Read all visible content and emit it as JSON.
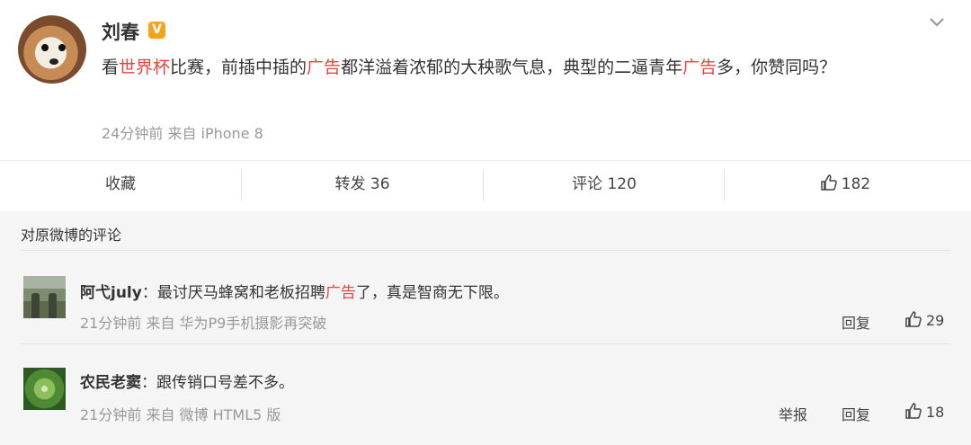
{
  "post": {
    "author": "刘春",
    "verified_badge": "V",
    "text_segments": [
      {
        "text": "看",
        "highlight": false
      },
      {
        "text": "世界杯",
        "highlight": true
      },
      {
        "text": "比赛，前插中插的",
        "highlight": false
      },
      {
        "text": "广告",
        "highlight": true
      },
      {
        "text": "都洋溢着浓郁的大秧歌气息，典型的二逼青年",
        "highlight": false
      },
      {
        "text": "广告",
        "highlight": true
      },
      {
        "text": "多，你赞同吗？",
        "highlight": false
      }
    ],
    "meta": "24分钟前 来自 iPhone 8",
    "icons": {
      "menu": "chevron-down-icon",
      "avatar": "dog-avatar"
    }
  },
  "actions": {
    "favorite": "收藏",
    "repost": "转发 36",
    "comment": "评论 120",
    "like_count": "182"
  },
  "comments": {
    "title": "对原微博的评论",
    "items": [
      {
        "user": "阿弋july",
        "separator": "：",
        "text_before": "最讨厌马蜂窝和老板招聘",
        "highlight": "广告",
        "text_after": "了，真是智商无下限。",
        "meta": "21分钟前 来自 华为P9手机摄影再突破",
        "reply": "回复",
        "likes": "29"
      },
      {
        "user": "农民老窦",
        "separator": "：",
        "text_before": "跟传销口号差不多。",
        "highlight": "",
        "text_after": "",
        "meta": "21分钟前 来自 微博 HTML5 版",
        "report": "举报",
        "reply": "回复",
        "likes": "18"
      }
    ]
  },
  "colors": {
    "highlight": "#e9443f",
    "badge": "#f7a21b",
    "muted": "#999999",
    "panel": "#f5f5f5"
  }
}
